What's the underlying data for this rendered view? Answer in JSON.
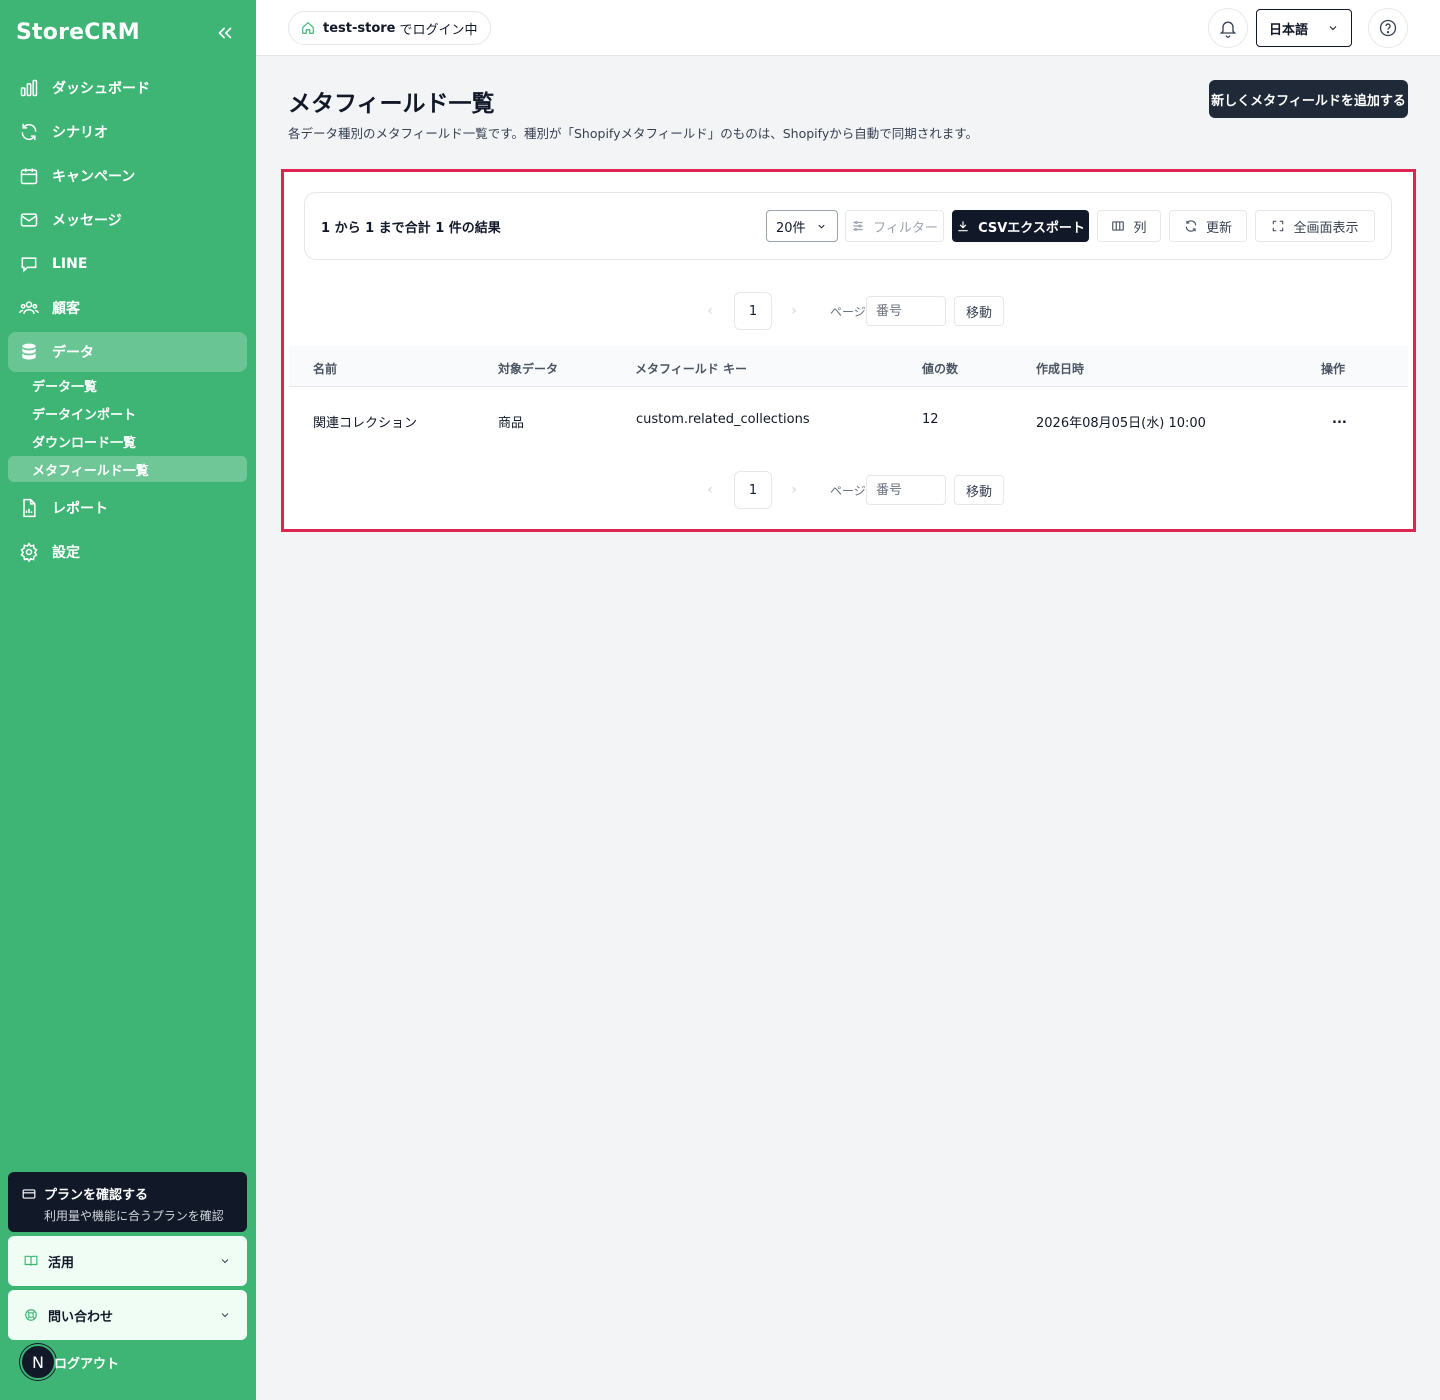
{
  "brand": "StoreCRM",
  "sidebar": {
    "items": [
      {
        "label": "ダッシュボード",
        "icon": "bar-chart-icon"
      },
      {
        "label": "シナリオ",
        "icon": "refresh-icon"
      },
      {
        "label": "キャンペーン",
        "icon": "calendar-icon"
      },
      {
        "label": "メッセージ",
        "icon": "mail-icon"
      },
      {
        "label": "LINE",
        "icon": "chat-icon"
      },
      {
        "label": "顧客",
        "icon": "users-icon"
      },
      {
        "label": "データ",
        "icon": "database-icon"
      },
      {
        "label": "レポート",
        "icon": "file-chart-icon"
      },
      {
        "label": "設定",
        "icon": "gear-icon"
      }
    ],
    "data_sub": [
      "データ一覧",
      "データインポート",
      "ダウンロード一覧",
      "メタフィールド一覧"
    ],
    "plan_title": "プランを確認する",
    "plan_sub": "利用量や機能に合うプランを確認",
    "usage": "活用",
    "contact": "問い合わせ",
    "logout": "ログアウト",
    "avatar": "N"
  },
  "topbar": {
    "store": "test-store",
    "store_suffix": "でログイン中",
    "language": "日本語"
  },
  "header": {
    "title": "メタフィールド一覧",
    "description": "各データ種別のメタフィールド一覧です。種別が「Shopifyメタフィールド」のものは、Shopifyから自動で同期されます。",
    "add_button": "新しくメタフィールドを追加する"
  },
  "toolbar": {
    "result": "1 から 1 まで合計 1 件の結果",
    "per_page": "20件",
    "filter": "フィルター",
    "csv": "CSVエクスポート",
    "columns": "列",
    "refresh": "更新",
    "fullscreen": "全画面表示"
  },
  "pagination": {
    "current": "1",
    "label": "ページ",
    "placeholder": "番号",
    "go": "移動"
  },
  "table": {
    "headers": [
      "名前",
      "対象データ",
      "メタフィールド キー",
      "値の数",
      "作成日時",
      "操作"
    ],
    "rows": [
      [
        "関連コレクション",
        "商品",
        "custom.related_collections",
        "12",
        "2026年08月05日(水) 10:00",
        "..."
      ]
    ]
  },
  "colors": {
    "sidebar": "#3fb575",
    "dark": "#111827",
    "highlight": "#dc2650"
  }
}
